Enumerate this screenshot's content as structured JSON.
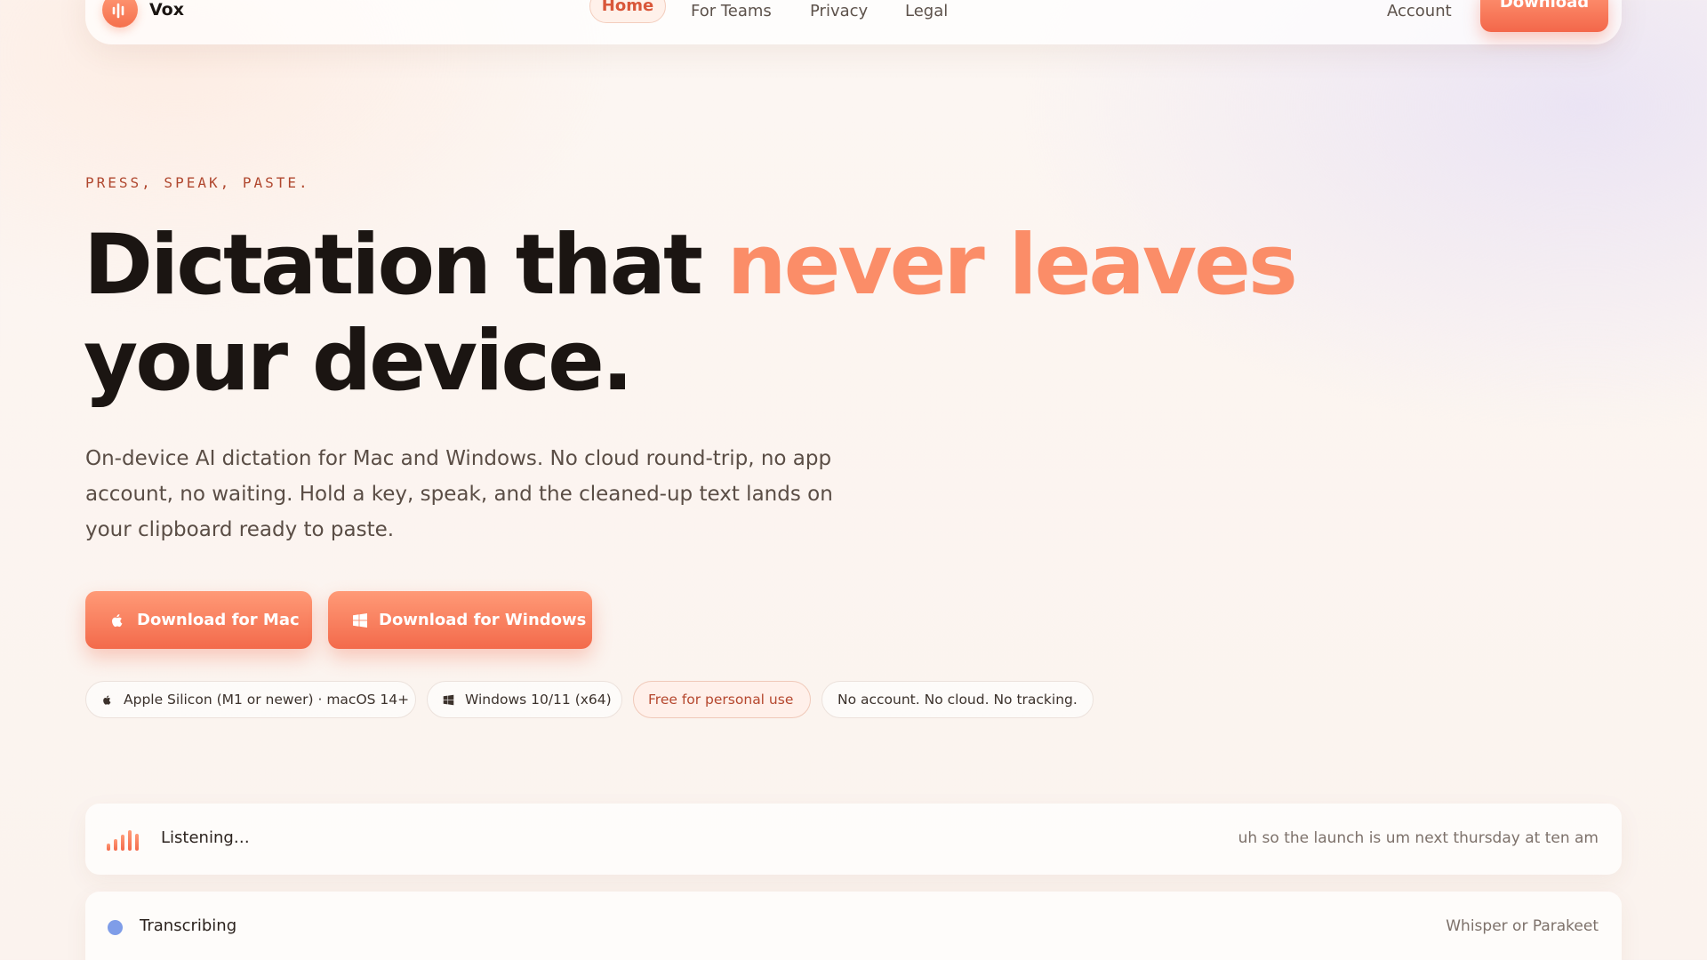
{
  "nav": {
    "brand": "Vox",
    "links": [
      "Home",
      "For Teams",
      "Privacy",
      "Legal"
    ],
    "active_link": "Home",
    "account": "Account",
    "download": "Download"
  },
  "hero": {
    "eyebrow": "PRESS, SPEAK, PASTE.",
    "headline_before": "Dictation that ",
    "headline_accent": "never leaves",
    "headline_after": " your device.",
    "lede": "On-device AI dictation for Mac and Windows. No cloud round-trip, no app account, no waiting. Hold a key, speak, and the cleaned-up text lands on your clipboard ready to paste.",
    "cta_mac": "Download for Mac",
    "cta_windows": "Download for Windows",
    "chips": {
      "apple": "Apple Silicon (M1 or newer) · macOS 14+",
      "windows": "Windows 10/11 (x64)",
      "free": "Free for personal use",
      "privacy": "No account. No cloud. No tracking."
    }
  },
  "status_cards": {
    "listening": {
      "label": "Listening…",
      "transcript": "uh so the launch is um next thursday at ten am",
      "level_bars": [
        0.35,
        0.55,
        0.75,
        0.95,
        0.8
      ]
    },
    "transcribing": {
      "label": "Transcribing",
      "engine": "Whisper or Parakeet"
    }
  },
  "colors": {
    "accent": "#f36a4b",
    "accent_light": "#fb8d68",
    "status_blue": "#7f9de8",
    "background": "#fbf4ef"
  },
  "icons": {
    "brand": "vox-logo-icon",
    "mac": "apple-icon",
    "windows": "windows-icon",
    "level": "audio-level-icon",
    "status": "status-dot-icon"
  }
}
